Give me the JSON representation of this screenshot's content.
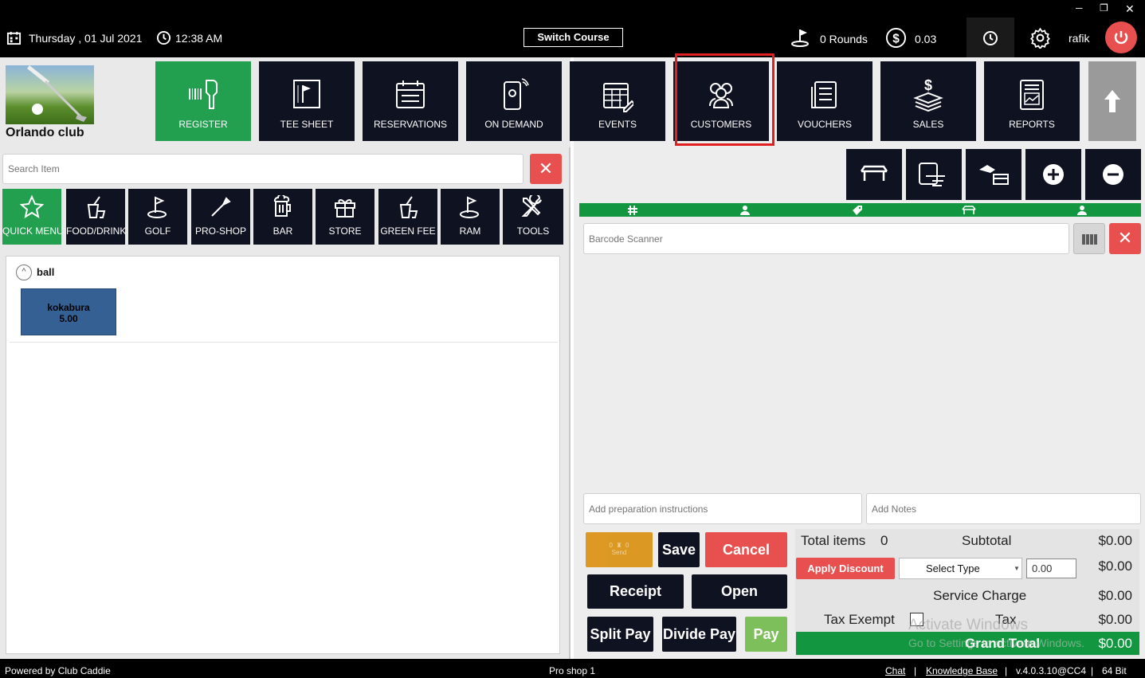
{
  "topbar": {
    "date": "Thursday ,  01 Jul 2021",
    "time": "12:38 AM",
    "switch_course": "Switch Course",
    "rounds": "0 Rounds",
    "balance": "0.03",
    "user": "rafik",
    "window_controls": [
      "─",
      "❐",
      "✕"
    ]
  },
  "club": {
    "name": "Orlando club"
  },
  "nav": [
    {
      "label": "REGISTER",
      "icon": "barcode-scanner-icon"
    },
    {
      "label": "TEE SHEET",
      "icon": "flag-sheet-icon"
    },
    {
      "label": "RESERVATIONS",
      "icon": "calendar-icon"
    },
    {
      "label": "ON DEMAND",
      "icon": "mobile-icon"
    },
    {
      "label": "EVENTS",
      "icon": "calendar-edit-icon"
    },
    {
      "label": "CUSTOMERS",
      "icon": "users-icon"
    },
    {
      "label": "VOUCHERS",
      "icon": "voucher-icon"
    },
    {
      "label": "SALES",
      "icon": "money-icon"
    },
    {
      "label": "REPORTS",
      "icon": "report-icon"
    }
  ],
  "search": {
    "placeholder": "Search Item"
  },
  "categories": [
    {
      "label": "QUICK MENU",
      "icon": "star-icon"
    },
    {
      "label": "FOOD/DRINK",
      "icon": "drink-icon"
    },
    {
      "label": "GOLF",
      "icon": "golf-icon"
    },
    {
      "label": "PRO-SHOP",
      "icon": "tag-icon"
    },
    {
      "label": "BAR",
      "icon": "beer-icon"
    },
    {
      "label": "STORE",
      "icon": "gift-icon"
    },
    {
      "label": "GREEN FEE",
      "icon": "drink-icon"
    },
    {
      "label": "RAM",
      "icon": "golf-icon"
    },
    {
      "label": "TOOLS",
      "icon": "tools-icon"
    }
  ],
  "items": {
    "group_name": "ball",
    "item_name": "kokabura",
    "item_price": "5.00"
  },
  "order": {
    "barcode_placeholder": "Barcode Scanner",
    "prep_placeholder": "Add preparation instructions",
    "notes_placeholder": "Add Notes",
    "send_label": "Send",
    "send_counts": [
      "0",
      "0"
    ]
  },
  "actions": {
    "save": "Save",
    "cancel": "Cancel",
    "receipt": "Receipt",
    "open": "Open",
    "split_pay": "Split Pay",
    "divide_pay": "Divide Pay",
    "pay": "Pay"
  },
  "totals": {
    "total_items_label": "Total items",
    "total_items": "0",
    "subtotal_label": "Subtotal",
    "subtotal": "$0.00",
    "apply_discount": "Apply Discount",
    "discount_type": "Select Type",
    "discount_value": "0.00",
    "discount_amount": "$0.00",
    "service_charge_label": "Service Charge",
    "service_charge": "$0.00",
    "tax_exempt_label": "Tax Exempt",
    "tax_label": "Tax",
    "tax": "$0.00",
    "grand_total_label": "Grand Total",
    "grand_total": "$0.00"
  },
  "watermark": {
    "line1": "Activate Windows",
    "line2": "Go to Settings to activate Windows."
  },
  "footer": {
    "powered": "Powered by Club Caddie",
    "station": "Pro shop 1",
    "chat": "Chat",
    "kb": "Knowledge Base",
    "version": "v.4.0.3.10@CC4",
    "arch": "64 Bit",
    "sep": "|"
  },
  "colors": {
    "green": "#22a050",
    "navy": "#0f1220",
    "red": "#e8504f",
    "orange": "#d98a00"
  }
}
